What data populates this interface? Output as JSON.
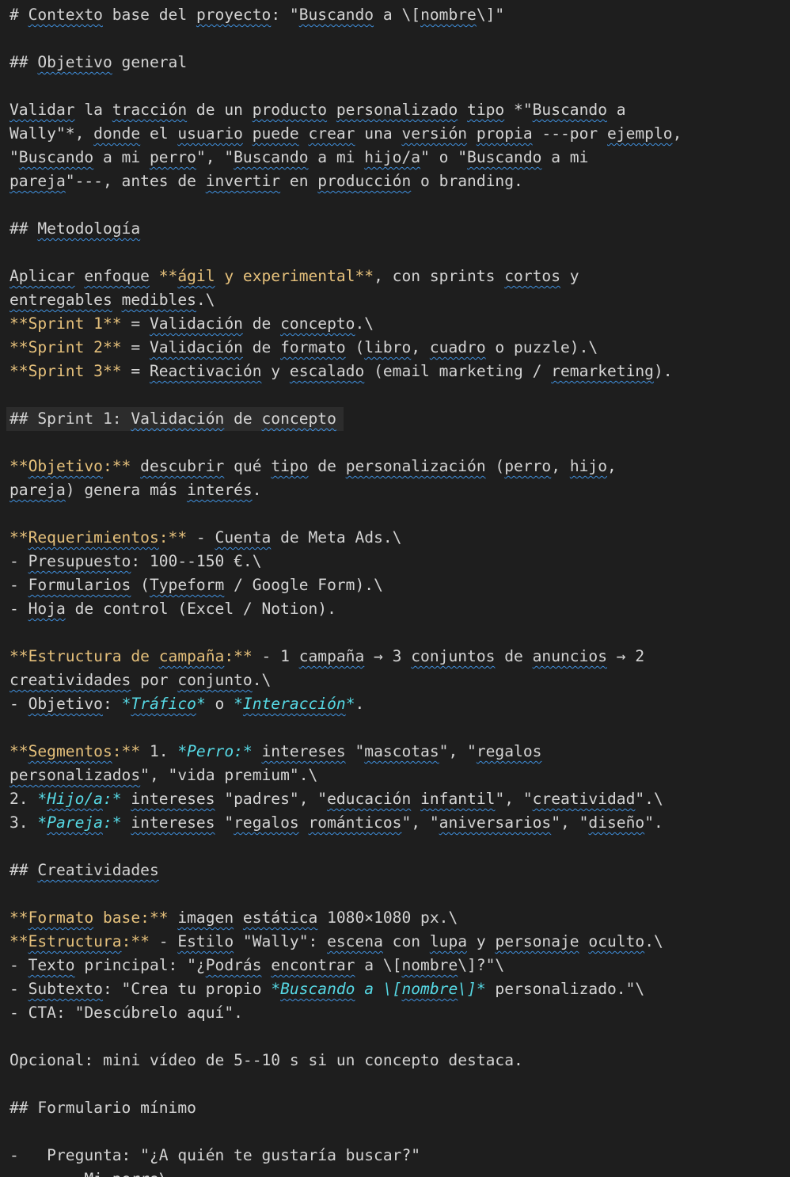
{
  "editor": {
    "colors": {
      "background": "#1e1e1e",
      "text": "#d4d4d4",
      "bold_markup": "#e5c07b",
      "italic_markup": "#56d8e4",
      "spell_squiggle": "#3f8fdc",
      "line_highlight": "#2c2c2c"
    },
    "lines": [
      {
        "row": 0,
        "segments": [
          {
            "text": "# "
          },
          {
            "text": "Contexto",
            "sq": true
          },
          {
            "text": " base del "
          },
          {
            "text": "proyecto",
            "sq": true
          },
          {
            "text": ": \""
          },
          {
            "text": "Buscando",
            "sq": true
          },
          {
            "text": " a \\["
          },
          {
            "text": "nombre",
            "sq": true
          },
          {
            "text": "\\]\""
          }
        ]
      },
      {
        "row": 2,
        "segments": [
          {
            "text": "## "
          },
          {
            "text": "Objetivo",
            "sq": true
          },
          {
            "text": " general"
          }
        ]
      },
      {
        "row": 4,
        "segments": [
          {
            "text": "Validar",
            "sq": true
          },
          {
            "text": " la "
          },
          {
            "text": "tracción",
            "sq": true
          },
          {
            "text": " de un "
          },
          {
            "text": "producto",
            "sq": true
          },
          {
            "text": " "
          },
          {
            "text": "personalizado",
            "sq": true
          },
          {
            "text": " "
          },
          {
            "text": "tipo",
            "sq": true
          },
          {
            "text": " *\""
          },
          {
            "text": "Buscando",
            "sq": true
          },
          {
            "text": " a"
          }
        ]
      },
      {
        "row": 5,
        "segments": [
          {
            "text": "Wally\"*, "
          },
          {
            "text": "donde",
            "sq": true
          },
          {
            "text": " el "
          },
          {
            "text": "usuario",
            "sq": true
          },
          {
            "text": " "
          },
          {
            "text": "puede",
            "sq": true
          },
          {
            "text": " "
          },
          {
            "text": "crear",
            "sq": true
          },
          {
            "text": " una "
          },
          {
            "text": "versión",
            "sq": true
          },
          {
            "text": " "
          },
          {
            "text": "propia",
            "sq": true
          },
          {
            "text": " ---por "
          },
          {
            "text": "ejemplo",
            "sq": true
          },
          {
            "text": ","
          }
        ]
      },
      {
        "row": 6,
        "segments": [
          {
            "text": "\""
          },
          {
            "text": "Buscando",
            "sq": true
          },
          {
            "text": " a mi "
          },
          {
            "text": "perro",
            "sq": true
          },
          {
            "text": "\", \""
          },
          {
            "text": "Buscando",
            "sq": true
          },
          {
            "text": " a mi "
          },
          {
            "text": "hijo/a",
            "sq": true
          },
          {
            "text": "\" o \""
          },
          {
            "text": "Buscando",
            "sq": true
          },
          {
            "text": " a mi"
          }
        ]
      },
      {
        "row": 7,
        "segments": [
          {
            "text": "pareja",
            "sq": true
          },
          {
            "text": "\"---, antes de "
          },
          {
            "text": "invertir",
            "sq": true
          },
          {
            "text": " en "
          },
          {
            "text": "producción",
            "sq": true
          },
          {
            "text": " o branding."
          }
        ]
      },
      {
        "row": 9,
        "segments": [
          {
            "text": "## "
          },
          {
            "text": "Metodología",
            "sq": true
          }
        ]
      },
      {
        "row": 11,
        "segments": [
          {
            "text": "Aplicar",
            "sq": true
          },
          {
            "text": " "
          },
          {
            "text": "enfoque",
            "sq": true
          },
          {
            "text": " "
          },
          {
            "text": "**",
            "c": "y"
          },
          {
            "text": "ágil",
            "c": "y",
            "sq": true
          },
          {
            "text": " y experimental**",
            "c": "y"
          },
          {
            "text": ", con sprints "
          },
          {
            "text": "cortos",
            "sq": true
          },
          {
            "text": " y"
          }
        ]
      },
      {
        "row": 12,
        "segments": [
          {
            "text": "entregables",
            "sq": true
          },
          {
            "text": " "
          },
          {
            "text": "medibles",
            "sq": true
          },
          {
            "text": ".\\"
          }
        ]
      },
      {
        "row": 13,
        "segments": [
          {
            "text": "**Sprint 1**",
            "c": "y"
          },
          {
            "text": " = "
          },
          {
            "text": "Validación",
            "sq": true
          },
          {
            "text": " de "
          },
          {
            "text": "concepto",
            "sq": true
          },
          {
            "text": ".\\"
          }
        ]
      },
      {
        "row": 14,
        "segments": [
          {
            "text": "**Sprint 2**",
            "c": "y"
          },
          {
            "text": " = "
          },
          {
            "text": "Validación",
            "sq": true
          },
          {
            "text": " de "
          },
          {
            "text": "formato",
            "sq": true
          },
          {
            "text": " ("
          },
          {
            "text": "libro",
            "sq": true
          },
          {
            "text": ", "
          },
          {
            "text": "cuadro",
            "sq": true
          },
          {
            "text": " o puzzle).\\"
          }
        ]
      },
      {
        "row": 15,
        "segments": [
          {
            "text": "**Sprint 3**",
            "c": "y"
          },
          {
            "text": " = "
          },
          {
            "text": "Reactivación",
            "sq": true
          },
          {
            "text": " y "
          },
          {
            "text": "escalado",
            "sq": true
          },
          {
            "text": " (email marketing / "
          },
          {
            "text": "remarketing",
            "sq": true
          },
          {
            "text": ")."
          }
        ]
      },
      {
        "row": 17,
        "segments": [
          {
            "text": "## Sprint 1: "
          },
          {
            "text": "Validación",
            "sq": true
          },
          {
            "text": " de "
          },
          {
            "text": "concepto",
            "sq": true
          }
        ]
      },
      {
        "row": 19,
        "segments": [
          {
            "text": "**",
            "c": "y"
          },
          {
            "text": "Objetivo",
            "c": "y",
            "sq": true
          },
          {
            "text": ":**",
            "c": "y"
          },
          {
            "text": " "
          },
          {
            "text": "descubrir",
            "sq": true
          },
          {
            "text": " qué "
          },
          {
            "text": "tipo",
            "sq": true
          },
          {
            "text": " de "
          },
          {
            "text": "personalización",
            "sq": true
          },
          {
            "text": " ("
          },
          {
            "text": "perro",
            "sq": true
          },
          {
            "text": ", "
          },
          {
            "text": "hijo",
            "sq": true
          },
          {
            "text": ","
          }
        ]
      },
      {
        "row": 20,
        "segments": [
          {
            "text": "pareja",
            "sq": true
          },
          {
            "text": ") genera más "
          },
          {
            "text": "interés",
            "sq": true
          },
          {
            "text": "."
          }
        ]
      },
      {
        "row": 22,
        "segments": [
          {
            "text": "**",
            "c": "y"
          },
          {
            "text": "Requerimientos",
            "c": "y",
            "sq": true
          },
          {
            "text": ":**",
            "c": "y"
          },
          {
            "text": " - "
          },
          {
            "text": "Cuenta",
            "sq": true
          },
          {
            "text": " de Meta Ads.\\"
          }
        ]
      },
      {
        "row": 23,
        "segments": [
          {
            "text": "- "
          },
          {
            "text": "Presupuesto",
            "sq": true
          },
          {
            "text": ": 100--150 €.\\"
          }
        ]
      },
      {
        "row": 24,
        "segments": [
          {
            "text": "- "
          },
          {
            "text": "Formularios",
            "sq": true
          },
          {
            "text": " ("
          },
          {
            "text": "Typeform",
            "sq": true
          },
          {
            "text": " / Google Form).\\"
          }
        ]
      },
      {
        "row": 25,
        "segments": [
          {
            "text": "- "
          },
          {
            "text": "Hoja",
            "sq": true
          },
          {
            "text": " de control (Excel / Notion)."
          }
        ]
      },
      {
        "row": 27,
        "segments": [
          {
            "text": "**Estructura de ",
            "c": "y"
          },
          {
            "text": "campaña",
            "c": "y",
            "sq": true
          },
          {
            "text": ":**",
            "c": "y"
          },
          {
            "text": " - 1 "
          },
          {
            "text": "campaña",
            "sq": true
          },
          {
            "text": " → 3 "
          },
          {
            "text": "conjuntos",
            "sq": true
          },
          {
            "text": " de "
          },
          {
            "text": "anuncios",
            "sq": true
          },
          {
            "text": " → 2"
          }
        ]
      },
      {
        "row": 28,
        "segments": [
          {
            "text": "creatividades",
            "sq": true
          },
          {
            "text": " por "
          },
          {
            "text": "conjunto",
            "sq": true
          },
          {
            "text": ".\\"
          }
        ]
      },
      {
        "row": 29,
        "segments": [
          {
            "text": "- "
          },
          {
            "text": "Objetivo",
            "sq": true
          },
          {
            "text": ": "
          },
          {
            "text": "*",
            "c": "i"
          },
          {
            "text": "Tráfico",
            "c": "i",
            "sq": true
          },
          {
            "text": "*",
            "c": "i"
          },
          {
            "text": " o "
          },
          {
            "text": "*",
            "c": "i"
          },
          {
            "text": "Interacción",
            "c": "i",
            "sq": true
          },
          {
            "text": "*",
            "c": "i"
          },
          {
            "text": "."
          }
        ]
      },
      {
        "row": 31,
        "segments": [
          {
            "text": "**",
            "c": "y"
          },
          {
            "text": "Segmentos",
            "c": "y",
            "sq": true
          },
          {
            "text": ":**",
            "c": "y"
          },
          {
            "text": " 1. "
          },
          {
            "text": "*Perro:*",
            "c": "i"
          },
          {
            "text": " "
          },
          {
            "text": "intereses",
            "sq": true
          },
          {
            "text": " \""
          },
          {
            "text": "mascotas",
            "sq": true
          },
          {
            "text": "\", \""
          },
          {
            "text": "regalos",
            "sq": true
          }
        ]
      },
      {
        "row": 32,
        "segments": [
          {
            "text": "personalizados",
            "sq": true
          },
          {
            "text": "\", \"vida premium\".\\"
          }
        ]
      },
      {
        "row": 33,
        "segments": [
          {
            "text": "2. "
          },
          {
            "text": "*",
            "c": "i"
          },
          {
            "text": "Hijo/a",
            "c": "i",
            "sq": true
          },
          {
            "text": ":*",
            "c": "i"
          },
          {
            "text": " "
          },
          {
            "text": "intereses",
            "sq": true
          },
          {
            "text": " \"padres\", \""
          },
          {
            "text": "educación",
            "sq": true
          },
          {
            "text": " "
          },
          {
            "text": "infantil",
            "sq": true
          },
          {
            "text": "\", \""
          },
          {
            "text": "creatividad",
            "sq": true
          },
          {
            "text": "\".\\"
          }
        ]
      },
      {
        "row": 34,
        "segments": [
          {
            "text": "3. "
          },
          {
            "text": "*",
            "c": "i"
          },
          {
            "text": "Pareja",
            "c": "i",
            "sq": true
          },
          {
            "text": ":*",
            "c": "i"
          },
          {
            "text": " "
          },
          {
            "text": "intereses",
            "sq": true
          },
          {
            "text": " \""
          },
          {
            "text": "regalos",
            "sq": true
          },
          {
            "text": " "
          },
          {
            "text": "románticos",
            "sq": true
          },
          {
            "text": "\", \""
          },
          {
            "text": "aniversarios",
            "sq": true
          },
          {
            "text": "\", \""
          },
          {
            "text": "diseño",
            "sq": true
          },
          {
            "text": "\"."
          }
        ]
      },
      {
        "row": 36,
        "segments": [
          {
            "text": "## "
          },
          {
            "text": "Creatividades",
            "sq": true
          }
        ]
      },
      {
        "row": 38,
        "segments": [
          {
            "text": "**",
            "c": "y"
          },
          {
            "text": "Formato",
            "c": "y",
            "sq": true
          },
          {
            "text": " base:**",
            "c": "y"
          },
          {
            "text": " "
          },
          {
            "text": "imagen",
            "sq": true
          },
          {
            "text": " "
          },
          {
            "text": "estática",
            "sq": true
          },
          {
            "text": " 1080×1080 px.\\"
          }
        ]
      },
      {
        "row": 39,
        "segments": [
          {
            "text": "**",
            "c": "y"
          },
          {
            "text": "Estructura",
            "c": "y",
            "sq": true
          },
          {
            "text": ":**",
            "c": "y"
          },
          {
            "text": " - "
          },
          {
            "text": "Estilo",
            "sq": true
          },
          {
            "text": " \"Wally\": "
          },
          {
            "text": "escena",
            "sq": true
          },
          {
            "text": " con "
          },
          {
            "text": "lupa",
            "sq": true
          },
          {
            "text": " y "
          },
          {
            "text": "personaje",
            "sq": true
          },
          {
            "text": " "
          },
          {
            "text": "oculto",
            "sq": true
          },
          {
            "text": ".\\"
          }
        ]
      },
      {
        "row": 40,
        "segments": [
          {
            "text": "- "
          },
          {
            "text": "Texto",
            "sq": true
          },
          {
            "text": " principal: \"¿"
          },
          {
            "text": "Podrás",
            "sq": true
          },
          {
            "text": " "
          },
          {
            "text": "encontrar",
            "sq": true
          },
          {
            "text": " a \\["
          },
          {
            "text": "nombre",
            "sq": true
          },
          {
            "text": "\\]?\"\\"
          }
        ]
      },
      {
        "row": 41,
        "segments": [
          {
            "text": "- "
          },
          {
            "text": "Subtexto",
            "sq": true
          },
          {
            "text": ": \"Crea tu propio "
          },
          {
            "text": "*",
            "c": "i"
          },
          {
            "text": "Buscando",
            "c": "i",
            "sq": true
          },
          {
            "text": " a \\[",
            "c": "i"
          },
          {
            "text": "nombre",
            "c": "i",
            "sq": true
          },
          {
            "text": "\\]*",
            "c": "i"
          },
          {
            "text": " personalizado.\"\\"
          }
        ]
      },
      {
        "row": 42,
        "segments": [
          {
            "text": "- CTA: \"Descúbrelo aquí\"."
          }
        ]
      },
      {
        "row": 44,
        "segments": [
          {
            "text": "Opcional: mini vídeo de 5--10 s si un concepto destaca."
          }
        ]
      },
      {
        "row": 46,
        "segments": [
          {
            "text": "## Formulario mínimo"
          }
        ]
      },
      {
        "row": 48,
        "segments": [
          {
            "text": "-   Pregunta: \"¿A quién te gustaría buscar?\""
          }
        ]
      },
      {
        "row": 49,
        "segments": [
          {
            "text": "        Mi perro\\"
          }
        ]
      }
    ]
  }
}
